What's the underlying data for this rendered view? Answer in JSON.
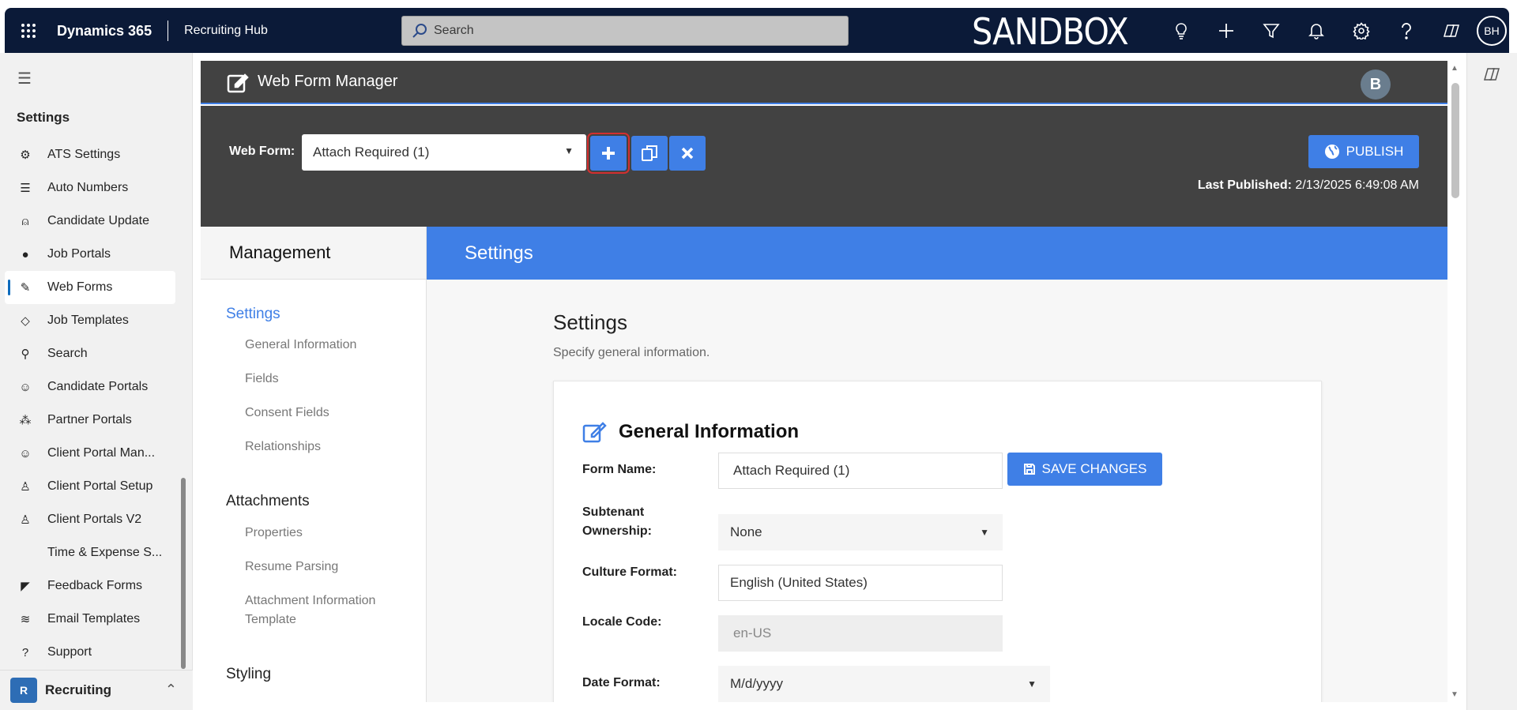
{
  "topbar": {
    "app_name": "Dynamics 365",
    "hub_name": "Recruiting Hub",
    "search_placeholder": "Search",
    "environment_label": "SANDBOX",
    "user_initials": "BH",
    "icons": [
      "lightbulb-icon",
      "add-icon",
      "filter-icon",
      "bell-icon",
      "gear-icon",
      "help-icon",
      "copilot-icon"
    ]
  },
  "sidebar": {
    "section_title": "Settings",
    "items": [
      {
        "label": "ATS Settings",
        "icon": "gear-icon"
      },
      {
        "label": "Auto Numbers",
        "icon": "numbered-list-icon"
      },
      {
        "label": "Candidate Update",
        "icon": "person-sync-icon"
      },
      {
        "label": "Job Portals",
        "icon": "globe-icon"
      },
      {
        "label": "Web Forms",
        "icon": "form-edit-icon",
        "active": true
      },
      {
        "label": "Job Templates",
        "icon": "template-gear-icon"
      },
      {
        "label": "Search",
        "icon": "search-people-icon"
      },
      {
        "label": "Candidate Portals",
        "icon": "people-icon"
      },
      {
        "label": "Partner Portals",
        "icon": "group-icon"
      },
      {
        "label": "Client Portal Man...",
        "icon": "people-settings-icon"
      },
      {
        "label": "Client Portal Setup",
        "icon": "person-icon"
      },
      {
        "label": "Client Portals V2",
        "icon": "person-icon"
      },
      {
        "label": "Time & Expense S...",
        "icon": ""
      },
      {
        "label": "Feedback Forms",
        "icon": "feedback-icon"
      },
      {
        "label": "Email Templates",
        "icon": "layers-icon"
      },
      {
        "label": "Support",
        "icon": "question-circle-icon"
      }
    ],
    "area": {
      "badge": "R",
      "label": "Recruiting"
    }
  },
  "webform": {
    "header_title": "Web Form Manager",
    "avatar_initial": "B",
    "web_form_label": "Web Form:",
    "selected_form": "Attach Required (1)",
    "publish_label": "PUBLISH",
    "last_published_label": "Last Published:",
    "last_published_value": "2/13/2025 6:49:08 AM"
  },
  "management": {
    "heading": "Management",
    "sections": [
      {
        "label": "Settings",
        "items": [
          "General Information",
          "Fields",
          "Consent Fields",
          "Relationships"
        ]
      },
      {
        "label": "Attachments",
        "items": [
          "Properties",
          "Resume Parsing",
          "Attachment Information Template"
        ]
      },
      {
        "label": "Styling",
        "items": []
      }
    ]
  },
  "settings_panel": {
    "band_title": "Settings",
    "title": "Settings",
    "subtitle": "Specify general information.",
    "card_title": "General Information",
    "save_label": "SAVE CHANGES",
    "fields": {
      "form_name_label": "Form Name:",
      "form_name_value": "Attach Required (1)",
      "subtenant_label": "Subtenant Ownership:",
      "subtenant_value": "None",
      "culture_label": "Culture Format:",
      "culture_value": "English (United States)",
      "locale_label": "Locale Code:",
      "locale_value": "en-US",
      "date_label": "Date Format:",
      "date_value": "M/d/yyyy"
    }
  },
  "colors": {
    "topbar": "#0b1a38",
    "accent": "#3f7fe6",
    "dark_panel": "#424242",
    "highlight_outline": "#d32f2f"
  }
}
